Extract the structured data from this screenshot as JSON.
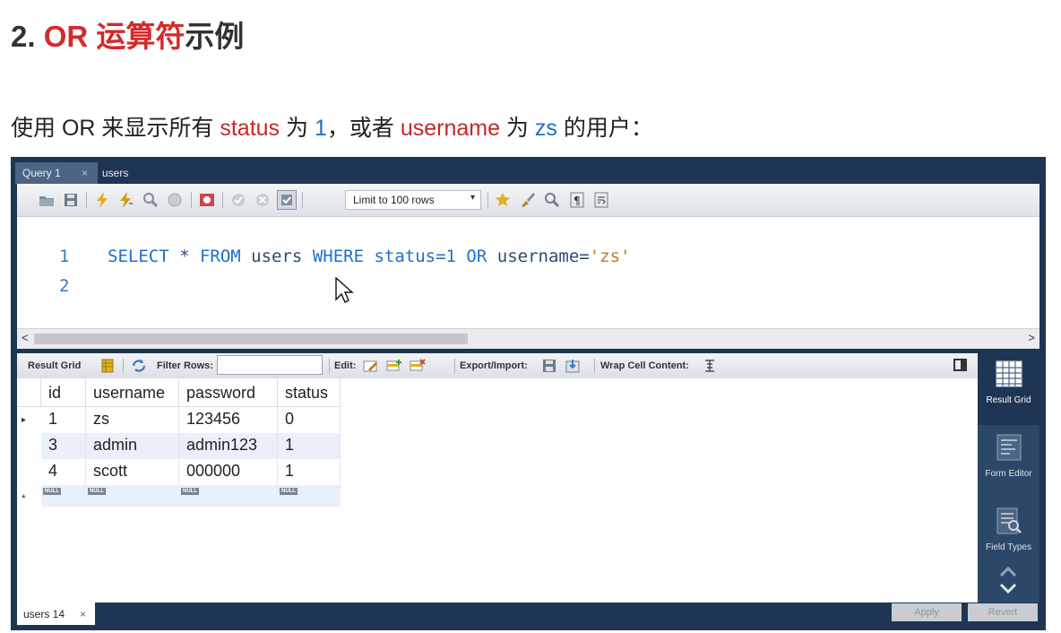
{
  "slide": {
    "title_prefix": "2. ",
    "title_highlight": "OR 运算符",
    "title_suffix": "示例",
    "desc_1": "使用 OR 来显示所有 ",
    "desc_status": "status",
    "desc_2": " 为 ",
    "desc_one": "1",
    "desc_3": "，或者 ",
    "desc_username": "username",
    "desc_4": " 为 ",
    "desc_zs": "zs",
    "desc_5": " 的用户："
  },
  "tabs": {
    "query_tab": "Query 1",
    "close_glyph": "×",
    "users_tab": "users"
  },
  "toolbar": {
    "limit_label": "Limit to 100 rows",
    "dropdown_glyph": "▾"
  },
  "editor": {
    "line_numbers": [
      "1",
      "2"
    ],
    "code": {
      "select": "SELECT",
      "star": " * ",
      "from": "FROM",
      "table": " users ",
      "where": "WHERE",
      "col1": " status=",
      "val1": "1",
      "or": " OR",
      "col2": " username=",
      "val2": "'zs'"
    }
  },
  "result_bar": {
    "result_grid": "Result Grid",
    "filter_rows": "Filter Rows:",
    "edit": "Edit:",
    "export_import": "Export/Import:",
    "wrap_cell": "Wrap Cell Content:"
  },
  "grid": {
    "columns": [
      "id",
      "username",
      "password",
      "status"
    ],
    "rows": [
      [
        "1",
        "zs",
        "123456",
        "0"
      ],
      [
        "3",
        "admin",
        "admin123",
        "1"
      ],
      [
        "4",
        "scott",
        "000000",
        "1"
      ]
    ],
    "null_label": "NULL",
    "current_row_marker": "▸",
    "new_row_marker": "*"
  },
  "side_panel": {
    "result_grid": "Result Grid",
    "form_editor": "Form Editor",
    "field_types": "Field Types"
  },
  "bottom": {
    "tab_label": "users 14",
    "close_glyph": "×",
    "apply": "Apply",
    "revert": "Revert"
  },
  "scroll": {
    "left": "<",
    "right": ">"
  },
  "colors": {
    "highlight_red": "#d42a2a",
    "highlight_blue": "#1f6fc5",
    "workbench_navy": "#1e3554",
    "sql_keyword": "#1e6fc9",
    "sql_string": "#c07a2a"
  }
}
